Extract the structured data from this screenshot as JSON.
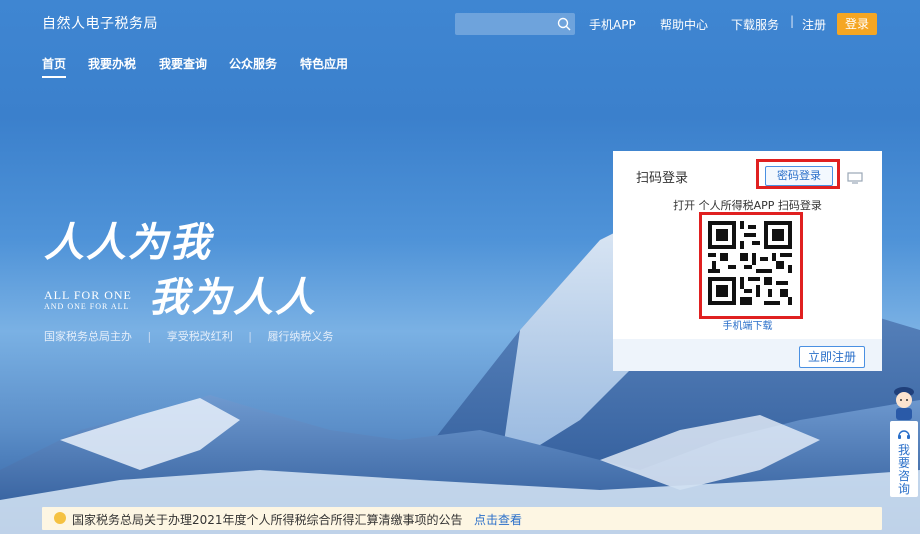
{
  "header": {
    "site_title": "自然人电子税务局",
    "search_placeholder": "",
    "links": [
      "手机APP",
      "帮助中心",
      "下载服务"
    ],
    "separator": "|",
    "register": "注册",
    "login": "登录"
  },
  "nav": {
    "items": [
      "首页",
      "我要办税",
      "我要查询",
      "公众服务",
      "特色应用"
    ],
    "active": "首页"
  },
  "hero": {
    "slogan_line1": "人人为我",
    "slogan_line2": "我为人人",
    "slogan_en1": "ALL FOR ONE",
    "slogan_en2": "AND ONE FOR ALL",
    "sub_items": [
      "国家税务总局主办",
      "享受税改红利",
      "履行纳税义务"
    ],
    "sub_separator": "|"
  },
  "login_panel": {
    "title": "扫码登录",
    "password_login": "密码登录",
    "hint": "打开 个人所得税APP 扫码登录",
    "download_link": "手机端下载",
    "register_button": "立即注册"
  },
  "side_widget": {
    "label": "我要咨询"
  },
  "notice": {
    "message": "国家税务总局关于办理2021年度个人所得税综合所得汇算清缴事项的公告",
    "link": "点击查看"
  },
  "colors": {
    "brand_blue": "#2a6fc9",
    "login_orange": "#f5a623",
    "highlight_red": "#e02020"
  }
}
